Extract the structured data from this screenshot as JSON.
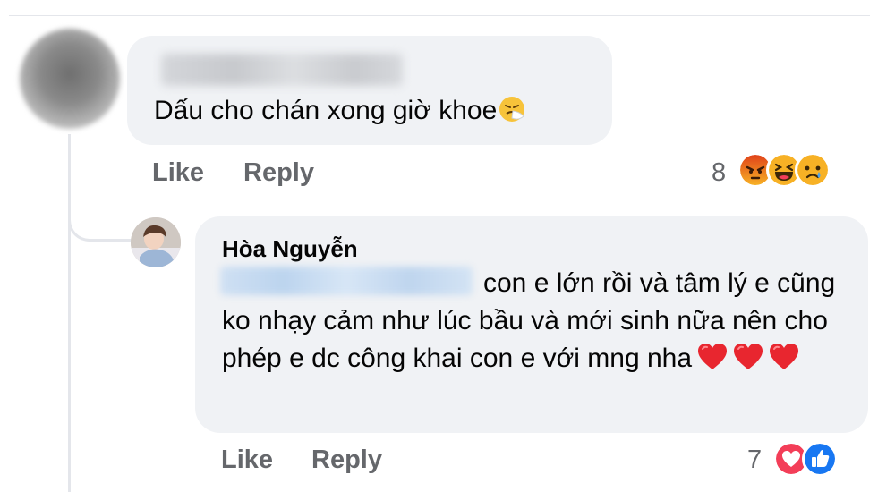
{
  "comment": {
    "text": "Dấu cho chán xong giờ khoe",
    "emoji": "sneezing-face-icon",
    "actions": {
      "like": "Like",
      "reply": "Reply"
    },
    "reaction_count": "8",
    "reactions": [
      "angry-reaction-icon",
      "haha-reaction-icon",
      "sad-reaction-icon"
    ]
  },
  "reply": {
    "author": "Hòa Nguyễn",
    "text_line1": "con e lớn rồi và tâm lý e",
    "text_rest": "cũng ko nhạy cảm như lúc bầu và mới sinh nữa nên cho phép e dc công khai con e với mng nha",
    "emoji": [
      "red-heart-icon",
      "red-heart-icon",
      "red-heart-icon"
    ],
    "actions": {
      "like": "Like",
      "reply": "Reply"
    },
    "reaction_count": "7",
    "reactions": [
      "love-reaction-icon",
      "like-reaction-icon"
    ]
  },
  "colors": {
    "bubble": "#f0f2f5",
    "action_text": "#65676b",
    "text": "#050505",
    "angry": "#e9710f",
    "haha": "#f7b125",
    "love": "#f33e58",
    "like": "#1877f2"
  }
}
